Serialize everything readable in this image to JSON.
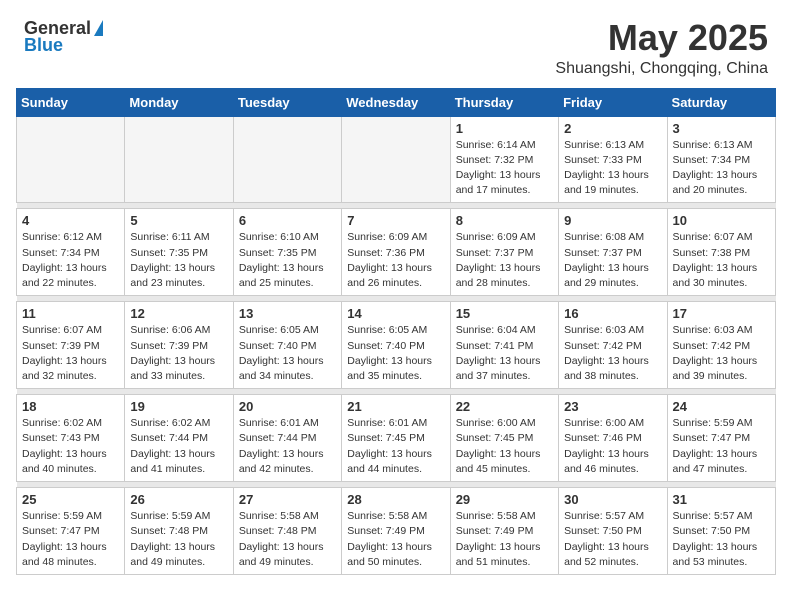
{
  "header": {
    "logo_general": "General",
    "logo_blue": "Blue",
    "month": "May 2025",
    "location": "Shuangshi, Chongqing, China"
  },
  "weekdays": [
    "Sunday",
    "Monday",
    "Tuesday",
    "Wednesday",
    "Thursday",
    "Friday",
    "Saturday"
  ],
  "weeks": [
    [
      {
        "day": "",
        "detail": ""
      },
      {
        "day": "",
        "detail": ""
      },
      {
        "day": "",
        "detail": ""
      },
      {
        "day": "",
        "detail": ""
      },
      {
        "day": "1",
        "detail": "Sunrise: 6:14 AM\nSunset: 7:32 PM\nDaylight: 13 hours\nand 17 minutes."
      },
      {
        "day": "2",
        "detail": "Sunrise: 6:13 AM\nSunset: 7:33 PM\nDaylight: 13 hours\nand 19 minutes."
      },
      {
        "day": "3",
        "detail": "Sunrise: 6:13 AM\nSunset: 7:34 PM\nDaylight: 13 hours\nand 20 minutes."
      }
    ],
    [
      {
        "day": "4",
        "detail": "Sunrise: 6:12 AM\nSunset: 7:34 PM\nDaylight: 13 hours\nand 22 minutes."
      },
      {
        "day": "5",
        "detail": "Sunrise: 6:11 AM\nSunset: 7:35 PM\nDaylight: 13 hours\nand 23 minutes."
      },
      {
        "day": "6",
        "detail": "Sunrise: 6:10 AM\nSunset: 7:35 PM\nDaylight: 13 hours\nand 25 minutes."
      },
      {
        "day": "7",
        "detail": "Sunrise: 6:09 AM\nSunset: 7:36 PM\nDaylight: 13 hours\nand 26 minutes."
      },
      {
        "day": "8",
        "detail": "Sunrise: 6:09 AM\nSunset: 7:37 PM\nDaylight: 13 hours\nand 28 minutes."
      },
      {
        "day": "9",
        "detail": "Sunrise: 6:08 AM\nSunset: 7:37 PM\nDaylight: 13 hours\nand 29 minutes."
      },
      {
        "day": "10",
        "detail": "Sunrise: 6:07 AM\nSunset: 7:38 PM\nDaylight: 13 hours\nand 30 minutes."
      }
    ],
    [
      {
        "day": "11",
        "detail": "Sunrise: 6:07 AM\nSunset: 7:39 PM\nDaylight: 13 hours\nand 32 minutes."
      },
      {
        "day": "12",
        "detail": "Sunrise: 6:06 AM\nSunset: 7:39 PM\nDaylight: 13 hours\nand 33 minutes."
      },
      {
        "day": "13",
        "detail": "Sunrise: 6:05 AM\nSunset: 7:40 PM\nDaylight: 13 hours\nand 34 minutes."
      },
      {
        "day": "14",
        "detail": "Sunrise: 6:05 AM\nSunset: 7:40 PM\nDaylight: 13 hours\nand 35 minutes."
      },
      {
        "day": "15",
        "detail": "Sunrise: 6:04 AM\nSunset: 7:41 PM\nDaylight: 13 hours\nand 37 minutes."
      },
      {
        "day": "16",
        "detail": "Sunrise: 6:03 AM\nSunset: 7:42 PM\nDaylight: 13 hours\nand 38 minutes."
      },
      {
        "day": "17",
        "detail": "Sunrise: 6:03 AM\nSunset: 7:42 PM\nDaylight: 13 hours\nand 39 minutes."
      }
    ],
    [
      {
        "day": "18",
        "detail": "Sunrise: 6:02 AM\nSunset: 7:43 PM\nDaylight: 13 hours\nand 40 minutes."
      },
      {
        "day": "19",
        "detail": "Sunrise: 6:02 AM\nSunset: 7:44 PM\nDaylight: 13 hours\nand 41 minutes."
      },
      {
        "day": "20",
        "detail": "Sunrise: 6:01 AM\nSunset: 7:44 PM\nDaylight: 13 hours\nand 42 minutes."
      },
      {
        "day": "21",
        "detail": "Sunrise: 6:01 AM\nSunset: 7:45 PM\nDaylight: 13 hours\nand 44 minutes."
      },
      {
        "day": "22",
        "detail": "Sunrise: 6:00 AM\nSunset: 7:45 PM\nDaylight: 13 hours\nand 45 minutes."
      },
      {
        "day": "23",
        "detail": "Sunrise: 6:00 AM\nSunset: 7:46 PM\nDaylight: 13 hours\nand 46 minutes."
      },
      {
        "day": "24",
        "detail": "Sunrise: 5:59 AM\nSunset: 7:47 PM\nDaylight: 13 hours\nand 47 minutes."
      }
    ],
    [
      {
        "day": "25",
        "detail": "Sunrise: 5:59 AM\nSunset: 7:47 PM\nDaylight: 13 hours\nand 48 minutes."
      },
      {
        "day": "26",
        "detail": "Sunrise: 5:59 AM\nSunset: 7:48 PM\nDaylight: 13 hours\nand 49 minutes."
      },
      {
        "day": "27",
        "detail": "Sunrise: 5:58 AM\nSunset: 7:48 PM\nDaylight: 13 hours\nand 49 minutes."
      },
      {
        "day": "28",
        "detail": "Sunrise: 5:58 AM\nSunset: 7:49 PM\nDaylight: 13 hours\nand 50 minutes."
      },
      {
        "day": "29",
        "detail": "Sunrise: 5:58 AM\nSunset: 7:49 PM\nDaylight: 13 hours\nand 51 minutes."
      },
      {
        "day": "30",
        "detail": "Sunrise: 5:57 AM\nSunset: 7:50 PM\nDaylight: 13 hours\nand 52 minutes."
      },
      {
        "day": "31",
        "detail": "Sunrise: 5:57 AM\nSunset: 7:50 PM\nDaylight: 13 hours\nand 53 minutes."
      }
    ]
  ]
}
